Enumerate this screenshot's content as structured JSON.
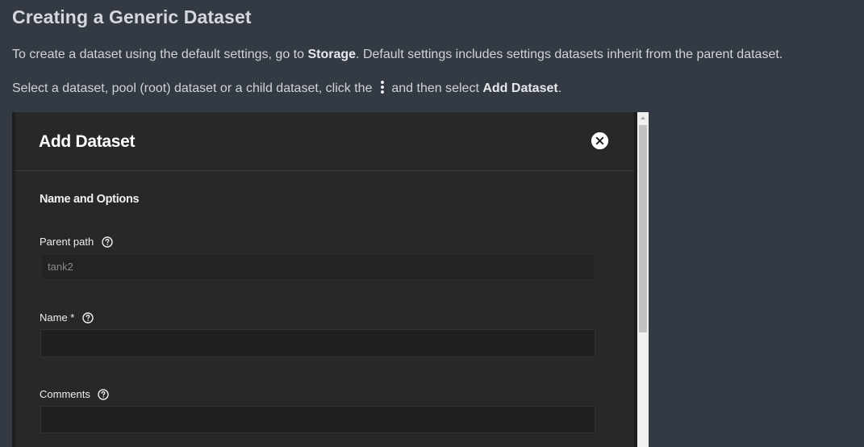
{
  "doc": {
    "title": "Creating a Generic Dataset",
    "para1": {
      "before": "To create a dataset using the default settings, go to ",
      "bold": "Storage",
      "after": ". Default settings includes settings datasets inherit from the parent dataset."
    },
    "para2": {
      "before": "Select a dataset, pool (root) dataset or a child dataset, click the ",
      "icon": "more-vert-icon",
      "middle": " and then select ",
      "bold": "Add Dataset",
      "after": "."
    }
  },
  "dialog": {
    "title": "Add Dataset",
    "close_icon": "close-circle-icon",
    "section_title": "Name and Options",
    "fields": {
      "parent_path": {
        "label": "Parent path",
        "value": "tank2",
        "help_icon": "help-circle-icon"
      },
      "name": {
        "label": "Name *",
        "value": "",
        "help_icon": "help-circle-icon"
      },
      "comments": {
        "label": "Comments",
        "value": "",
        "help_icon": "help-circle-icon"
      }
    }
  },
  "colors": {
    "page_bg": "#343a44",
    "dialog_bg": "#282828",
    "input_bg": "#202020",
    "text": "#d0d3d8"
  }
}
